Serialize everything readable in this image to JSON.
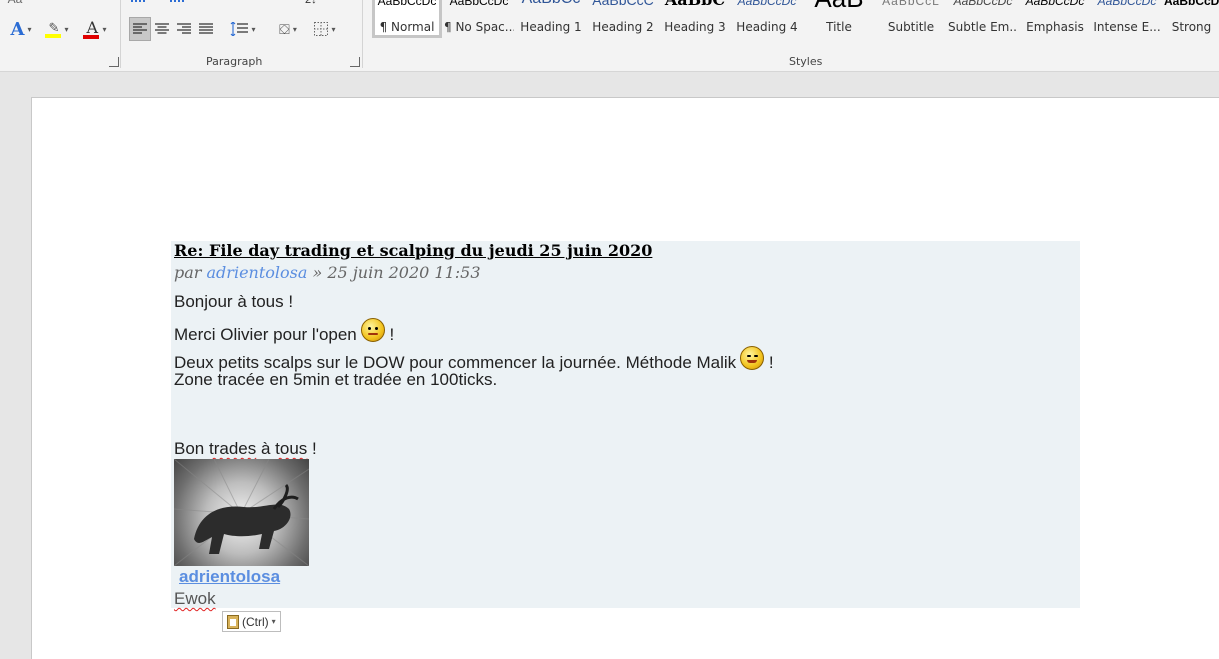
{
  "ribbon": {
    "paragraph_label": "Paragraph",
    "styles_label": "Styles",
    "font_size_stub": "Aa",
    "styles": [
      {
        "preview": "AaBbCcDc",
        "name": "¶ Normal",
        "selected": true
      },
      {
        "preview": "AaBbCcDc",
        "name": "¶ No Spac...",
        "selected": false
      },
      {
        "preview": "AaBbCc",
        "name": "Heading 1",
        "selected": false
      },
      {
        "preview": "AaBbCcC",
        "name": "Heading 2",
        "selected": false
      },
      {
        "preview": "AaBbC",
        "name": "Heading 3",
        "selected": false
      },
      {
        "preview": "AaBbCcDc",
        "name": "Heading 4",
        "selected": false
      },
      {
        "preview": "AaB",
        "name": "Title",
        "selected": false
      },
      {
        "preview": "AaBbCcL",
        "name": "Subtitle",
        "selected": false
      },
      {
        "preview": "AaBbCcDc",
        "name": "Subtle Em...",
        "selected": false
      },
      {
        "preview": "AaBbCcDc",
        "name": "Emphasis",
        "selected": false
      },
      {
        "preview": "AaBbCcDc",
        "name": "Intense E...",
        "selected": false
      },
      {
        "preview": "AaBbCcDc",
        "name": "Strong",
        "selected": false
      }
    ]
  },
  "post": {
    "title": "Re: File day trading et scalping du jeudi 25 juin 2020",
    "meta_prefix": "par ",
    "author": "adrientolosa",
    "meta_suffix": " » 25 juin 2020 11:53",
    "line1": "Bonjour à tous !",
    "line2a": "Merci Olivier pour l'open",
    "line2b": "!",
    "line3a": "Deux petits scalps sur le DOW pour commencer la journée. Méthode Malik",
    "line3b": "!",
    "line4": "Zone tracée en 5min et tradée en 100ticks.",
    "line5a": "Bon ",
    "line5b": "trades",
    "line5c": " à ",
    "line5d": "tous",
    "line5e": " !",
    "sig_name": "adrientolosa",
    "sig_rank": "Ewok"
  },
  "paste_options": {
    "label": "(Ctrl)"
  }
}
